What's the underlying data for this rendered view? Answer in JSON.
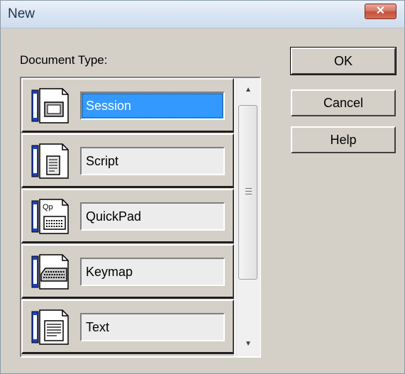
{
  "window": {
    "title": "New",
    "close_glyph": "✕"
  },
  "document_type_label": "Document Type:",
  "document_types": [
    {
      "label": "Session",
      "icon": "session-icon",
      "selected": true
    },
    {
      "label": "Script",
      "icon": "script-icon",
      "selected": false
    },
    {
      "label": "QuickPad",
      "icon": "quickpad-icon",
      "selected": false
    },
    {
      "label": "Keymap",
      "icon": "keymap-icon",
      "selected": false
    },
    {
      "label": "Text",
      "icon": "text-document-icon",
      "selected": false
    }
  ],
  "quickpad_icon_text": "Qp",
  "buttons": {
    "ok": "OK",
    "cancel": "Cancel",
    "help": "Help"
  },
  "colors": {
    "dialog_bg": "#d4d0c8",
    "selection": "#3399ff",
    "close_button": "#c4503b"
  }
}
